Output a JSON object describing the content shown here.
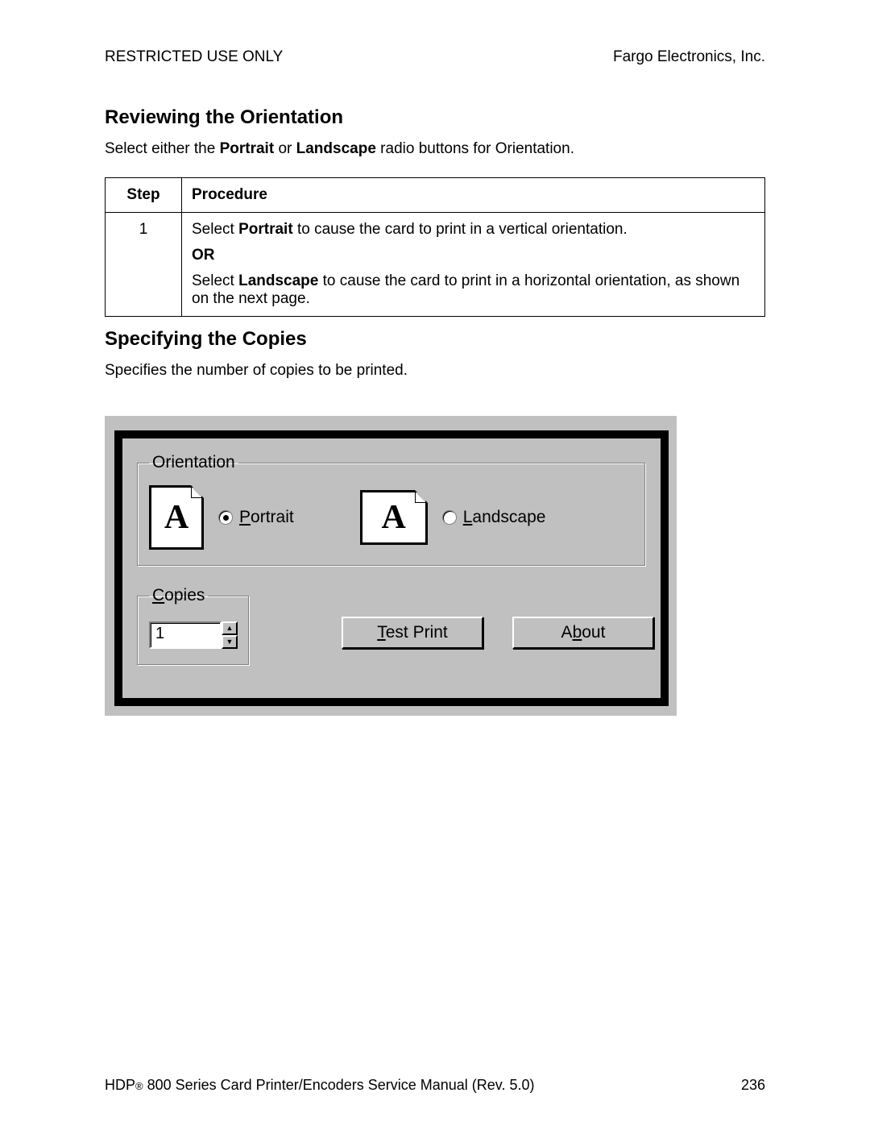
{
  "header": {
    "left": "RESTRICTED USE ONLY",
    "right": "Fargo Electronics, Inc."
  },
  "section1": {
    "title": "Reviewing the Orientation",
    "intro_pre": "Select either the ",
    "intro_b1": "Portrait",
    "intro_mid": " or ",
    "intro_b2": "Landscape",
    "intro_post": " radio buttons for Orientation."
  },
  "table": {
    "head_step": "Step",
    "head_proc": "Procedure",
    "row1": {
      "step": "1",
      "l1_pre": "Select ",
      "l1_b": "Portrait",
      "l1_post": " to cause the card to print in a vertical orientation.",
      "or": "OR",
      "l2_pre": "Select ",
      "l2_b": "Landscape",
      "l2_post": " to cause the card to print in a horizontal orientation, as shown on the next page."
    }
  },
  "section2": {
    "title": "Specifying the Copies",
    "intro": "Specifies the number of copies to be printed."
  },
  "dialog": {
    "orientation_legend": "Orientation",
    "portrait_first": "P",
    "portrait_rest": "ortrait",
    "landscape_first": "L",
    "landscape_rest": "andscape",
    "icon_letter": "A",
    "copies_first": "C",
    "copies_rest": "opies",
    "copies_value": "1",
    "test_first": "T",
    "test_rest": "est Print",
    "about_pre": "A",
    "about_u": "b",
    "about_post": "out"
  },
  "footer": {
    "left_pre": "HDP",
    "left_reg": "®",
    "left_post": " 800 Series Card Printer/Encoders Service Manual (Rev. 5.0)",
    "page": "236"
  }
}
